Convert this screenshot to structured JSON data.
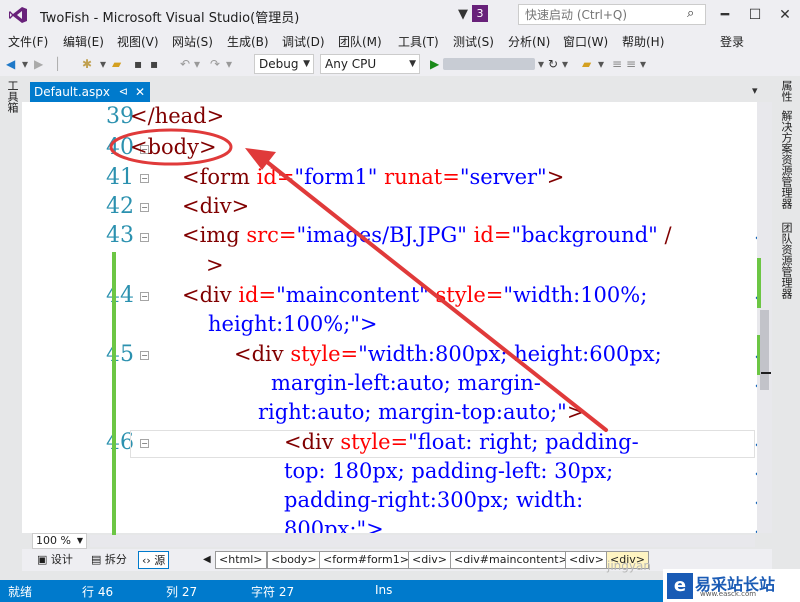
{
  "window": {
    "title": "TwoFish - Microsoft Visual Studio(管理员)",
    "notification_count": "3",
    "quick_launch_placeholder": "快速启动 (Ctrl+Q)",
    "minimize": "━",
    "restore": "☐",
    "close": "✕"
  },
  "menu": {
    "items": [
      "文件(F)",
      "编辑(E)",
      "视图(V)",
      "网站(S)",
      "生成(B)",
      "调试(D)",
      "团队(M)",
      "工具(T)",
      "测试(S)",
      "分析(N)",
      "窗口(W)",
      "帮助(H)"
    ],
    "login": "登录"
  },
  "toolbar": {
    "config": "Debug",
    "platform": "Any CPU"
  },
  "side_panels": {
    "left": "工具箱",
    "right": [
      "属性",
      "解决方案资源管理器",
      "团队资源管理器"
    ]
  },
  "document_tab": {
    "label": "Default.aspx",
    "pin": "⊲",
    "close": "✕"
  },
  "editor": {
    "line_numbers": [
      "39",
      "40",
      "41",
      "42",
      "43",
      "44",
      "45",
      "46"
    ],
    "code": {
      "l39": "</head>",
      "l40": "<body>",
      "l41_tag": "<form",
      "l41_attr1": "id=",
      "l41_val1": "\"form1\"",
      "l41_attr2": "runat=",
      "l41_val2": "\"server\"",
      "l41_end": ">",
      "l42": "<div>",
      "l43_tag": "<img",
      "l43_attr1": "src=",
      "l43_val1": "\"images/BJ.JPG\"",
      "l43_attr2": "id=",
      "l43_val2": "\"background\"",
      "l43_end": "/",
      "l43b": ">",
      "l44_tag": "<div",
      "l44_attr1": "id=",
      "l44_val1": "\"maincontent\"",
      "l44_attr2": "style=",
      "l44_val2": "\"width:100%;",
      "l44b": "height:100%;\">",
      "l45_tag": "<div",
      "l45_attr": "style=",
      "l45_val": "\"width:800px; height:600px;",
      "l45b": "margin-left:auto; margin-",
      "l45c_val": "right:auto; margin-top:auto;\"",
      "l45c_end": ">",
      "l46_tag": "<div",
      "l46_attr": "style=",
      "l46_val": "\"float: right; padding-",
      "l46b": "top: 180px; padding-left: 30px;",
      "l46c": "padding-right:300px; width:",
      "l46d": "800px;\">"
    },
    "wrap_glyph": "↩"
  },
  "zoom": "100 %",
  "views": {
    "design": "设计",
    "split": "拆分",
    "source": "源"
  },
  "breadcrumbs": [
    "<html>",
    "<body>",
    "<form#form1>",
    "<div>",
    "<div#maincontent>",
    "<div>",
    "<div>"
  ],
  "status": {
    "ready": "就绪",
    "line": "行 46",
    "col": "列 27",
    "char": "字符 27",
    "mode": "Ins"
  },
  "watermark": {
    "faint": "jingyan",
    "main": "易采站长站",
    "sub": "www.easck.com",
    "logo_letter": "e"
  },
  "colors": {
    "accent": "#007acc",
    "vs_purple": "#68217a",
    "annotation_red": "#e03a3a",
    "tag": "#800000",
    "attribute": "#ff0000",
    "value": "#0000ff",
    "line_number": "#2b91af",
    "change_bar": "#6cc644"
  }
}
